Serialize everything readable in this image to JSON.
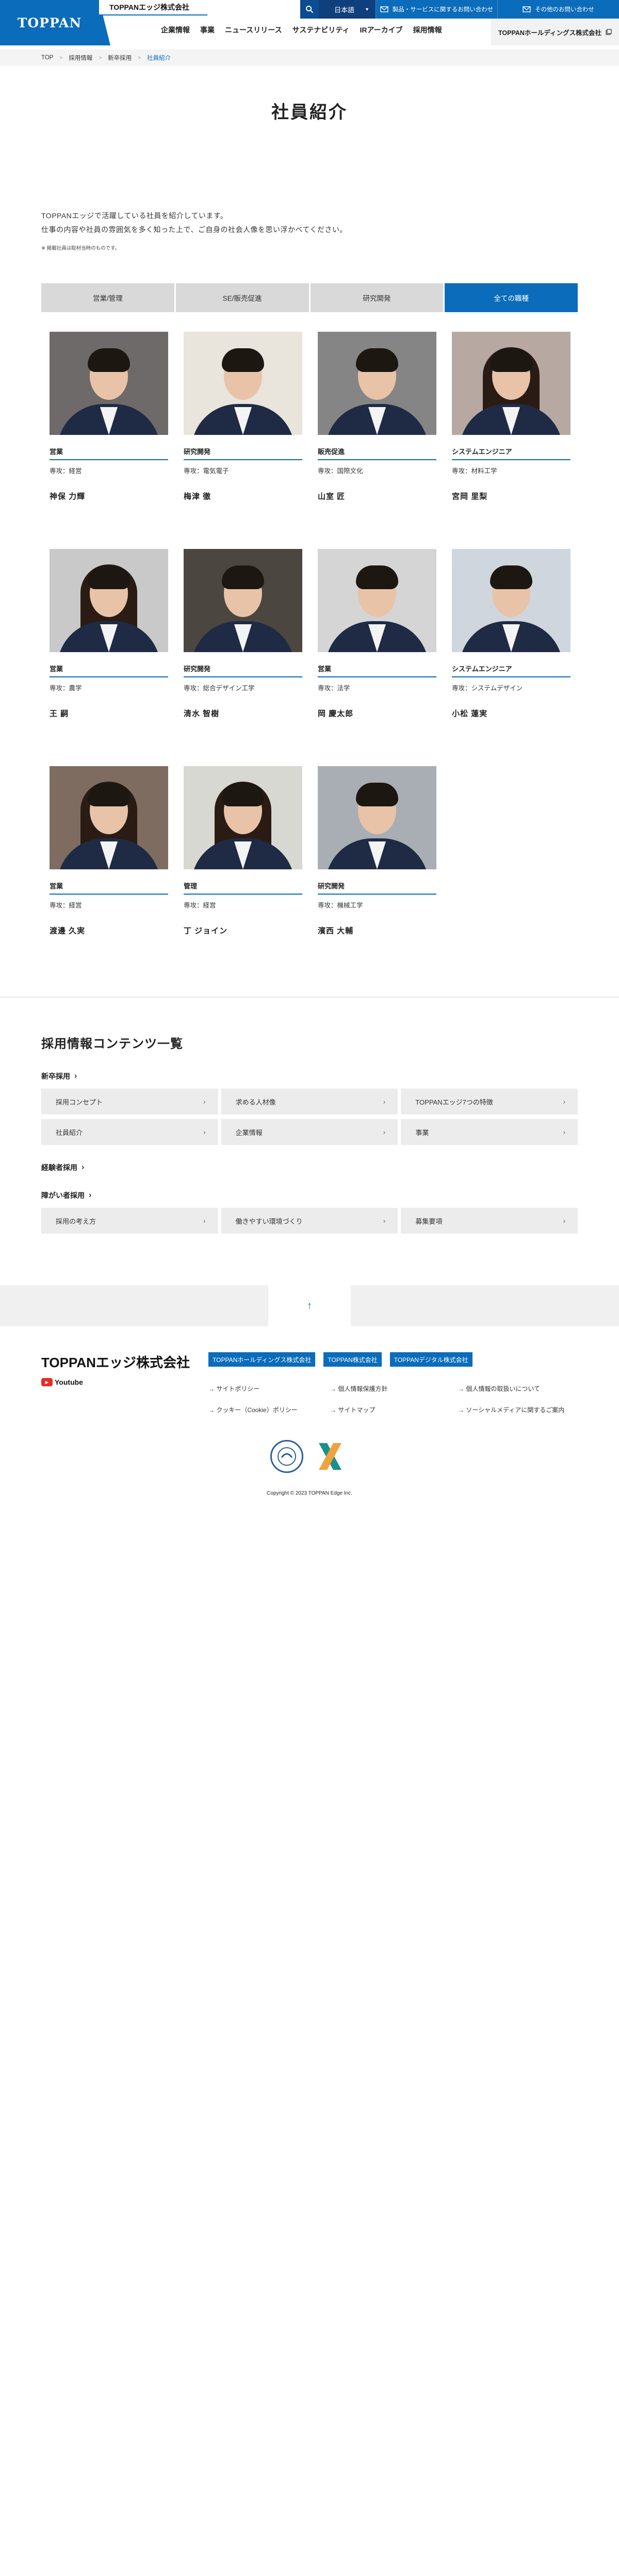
{
  "header": {
    "logo": "TOPPAN",
    "company": "TOPPANエッジ株式会社",
    "language": "日本語",
    "contact_products": "製品・サービスに関するお問い合わせ",
    "contact_other": "その他のお問い合わせ",
    "nav": [
      "企業情報",
      "事業",
      "ニュースリリース",
      "サステナビリティ",
      "IRアーカイブ",
      "採用情報"
    ],
    "holdings": "TOPPANホールディングス株式会社"
  },
  "breadcrumb": [
    "TOP",
    "採用情報",
    "新卒採用",
    "社員紹介"
  ],
  "page": {
    "title": "社員紹介",
    "intro_lines": [
      "TOPPANエッジで活躍している社員を紹介しています。",
      "仕事の内容や社員の雰囲気を多く知った上で、ご自身の社会人像を思い浮かべてください。"
    ],
    "note": "※ 掲載社員は取材当時のものです。"
  },
  "filters": [
    {
      "label": "営業/管理",
      "active": false
    },
    {
      "label": "SE/販売促進",
      "active": false
    },
    {
      "label": "研究開発",
      "active": false
    },
    {
      "label": "全ての職種",
      "active": true
    }
  ],
  "employees": [
    {
      "dept": "営業",
      "major": "専攻：経営",
      "name": "神保 力輝",
      "bg": "#6e6a6a",
      "style": "short"
    },
    {
      "dept": "研究開発",
      "major": "専攻：電気電子",
      "name": "梅津 徹",
      "bg": "#e9e4dc",
      "style": "short"
    },
    {
      "dept": "販売促進",
      "major": "専攻：国際文化",
      "name": "山室 匠",
      "bg": "#858585",
      "style": "short"
    },
    {
      "dept": "システムエンジニア",
      "major": "専攻：材料工学",
      "name": "宮岡 里梨",
      "bg": "#b7a9a2",
      "style": "long"
    },
    {
      "dept": "営業",
      "major": "専攻：農学",
      "name": "王 嗣",
      "bg": "#c9c9c9",
      "style": "long"
    },
    {
      "dept": "研究開発",
      "major": "専攻：総合デザイン工学",
      "name": "清水 智樹",
      "bg": "#4b4640",
      "style": "short"
    },
    {
      "dept": "営業",
      "major": "専攻：法学",
      "name": "岡 慶太郎",
      "bg": "#d5d5d5",
      "style": "short"
    },
    {
      "dept": "システムエンジニア",
      "major": "専攻：システムデザイン",
      "name": "小松 蓮実",
      "bg": "#cfd6de",
      "style": "short"
    },
    {
      "dept": "営業",
      "major": "専攻：経営",
      "name": "渡邊 久実",
      "bg": "#7e6c60",
      "style": "long"
    },
    {
      "dept": "管理",
      "major": "専攻：経営",
      "name": "丁 ジョイン",
      "bg": "#d8d8d2",
      "style": "long"
    },
    {
      "dept": "研究開発",
      "major": "専攻：機械工学",
      "name": "濱西 大輔",
      "bg": "#a9aeb4",
      "style": "short"
    }
  ],
  "recruit": {
    "title": "採用情報コンテンツ一覧",
    "categories": [
      {
        "label": "新卒採用",
        "links": [
          "採用コンセプト",
          "求める人材像",
          "TOPPANエッジ7つの特徴",
          "社員紹介",
          "企業情報",
          "事業"
        ]
      },
      {
        "label": "経験者採用",
        "links": []
      },
      {
        "label": "障がい者採用",
        "links": [
          "採用の考え方",
          "働きやすい環境づくり",
          "募集要項"
        ]
      }
    ]
  },
  "pagetop": "↑",
  "footer": {
    "company": "TOPPANエッジ株式会社",
    "youtube": "Youtube",
    "group": [
      "TOPPANホールディングス株式会社",
      "TOPPAN株式会社",
      "TOPPANデジタル株式会社"
    ],
    "links": [
      "サイトポリシー",
      "個人情報保護方針",
      "個人情報の取扱いについて",
      "クッキー（Cookie）ポリシー",
      "サイトマップ",
      "ソーシャルメディアに関するご案内"
    ],
    "copyright": "Copyright © 2023 TOPPAN Edge Inc."
  },
  "colors": {
    "brand": "#0a6cba",
    "navy": "#0f3f7c"
  }
}
